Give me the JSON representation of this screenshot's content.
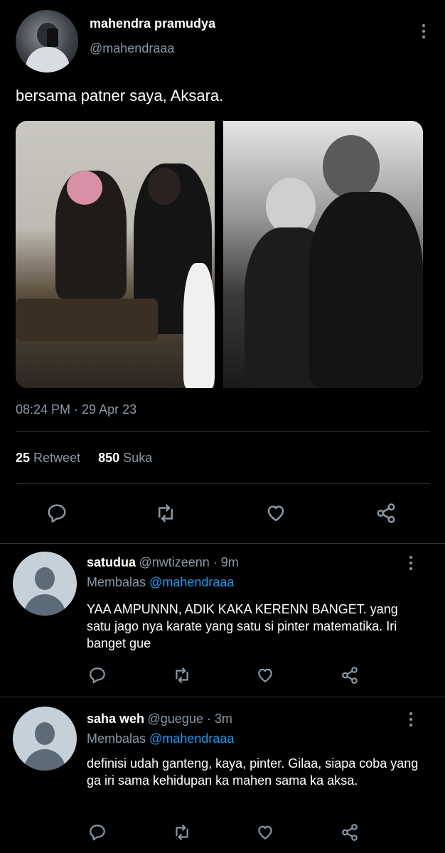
{
  "tweet": {
    "author_name": "mahendra pramudya",
    "author_handle": "@mahendraaa",
    "text": "bersama patner saya, Aksara.",
    "timestamp": "08:24 PM · 29 Apr 23",
    "retweet_count": "25",
    "retweet_label": "Retweet",
    "like_count": "850",
    "like_label": "Suka"
  },
  "replies": [
    {
      "name": "satudua",
      "meta": "@nwtizeenn · 9m",
      "replying_prefix": "Membalas",
      "replying_to": "@mahendraaa",
      "text": "YAA AMPUNNN, ADIK KAKA KERENN BANGET. yang satu jago nya karate yang satu si pinter matematika. Iri banget gue"
    },
    {
      "name": "saha weh",
      "meta": "@guegue · 3m",
      "replying_prefix": "Membalas",
      "replying_to": "@mahendraaa",
      "text": "definisi udah ganteng, kaya, pinter. Gilaa, siapa coba yang ga iri sama kehidupan ka mahen sama ka aksa."
    }
  ],
  "icons": [
    "reply-icon",
    "retweet-icon",
    "like-icon",
    "share-icon",
    "more-icon"
  ],
  "colors": {
    "background": "#000000",
    "text": "#e7e9ea",
    "muted": "#8b98a5",
    "link": "#1d9bf0",
    "divider": "#2f3336"
  }
}
